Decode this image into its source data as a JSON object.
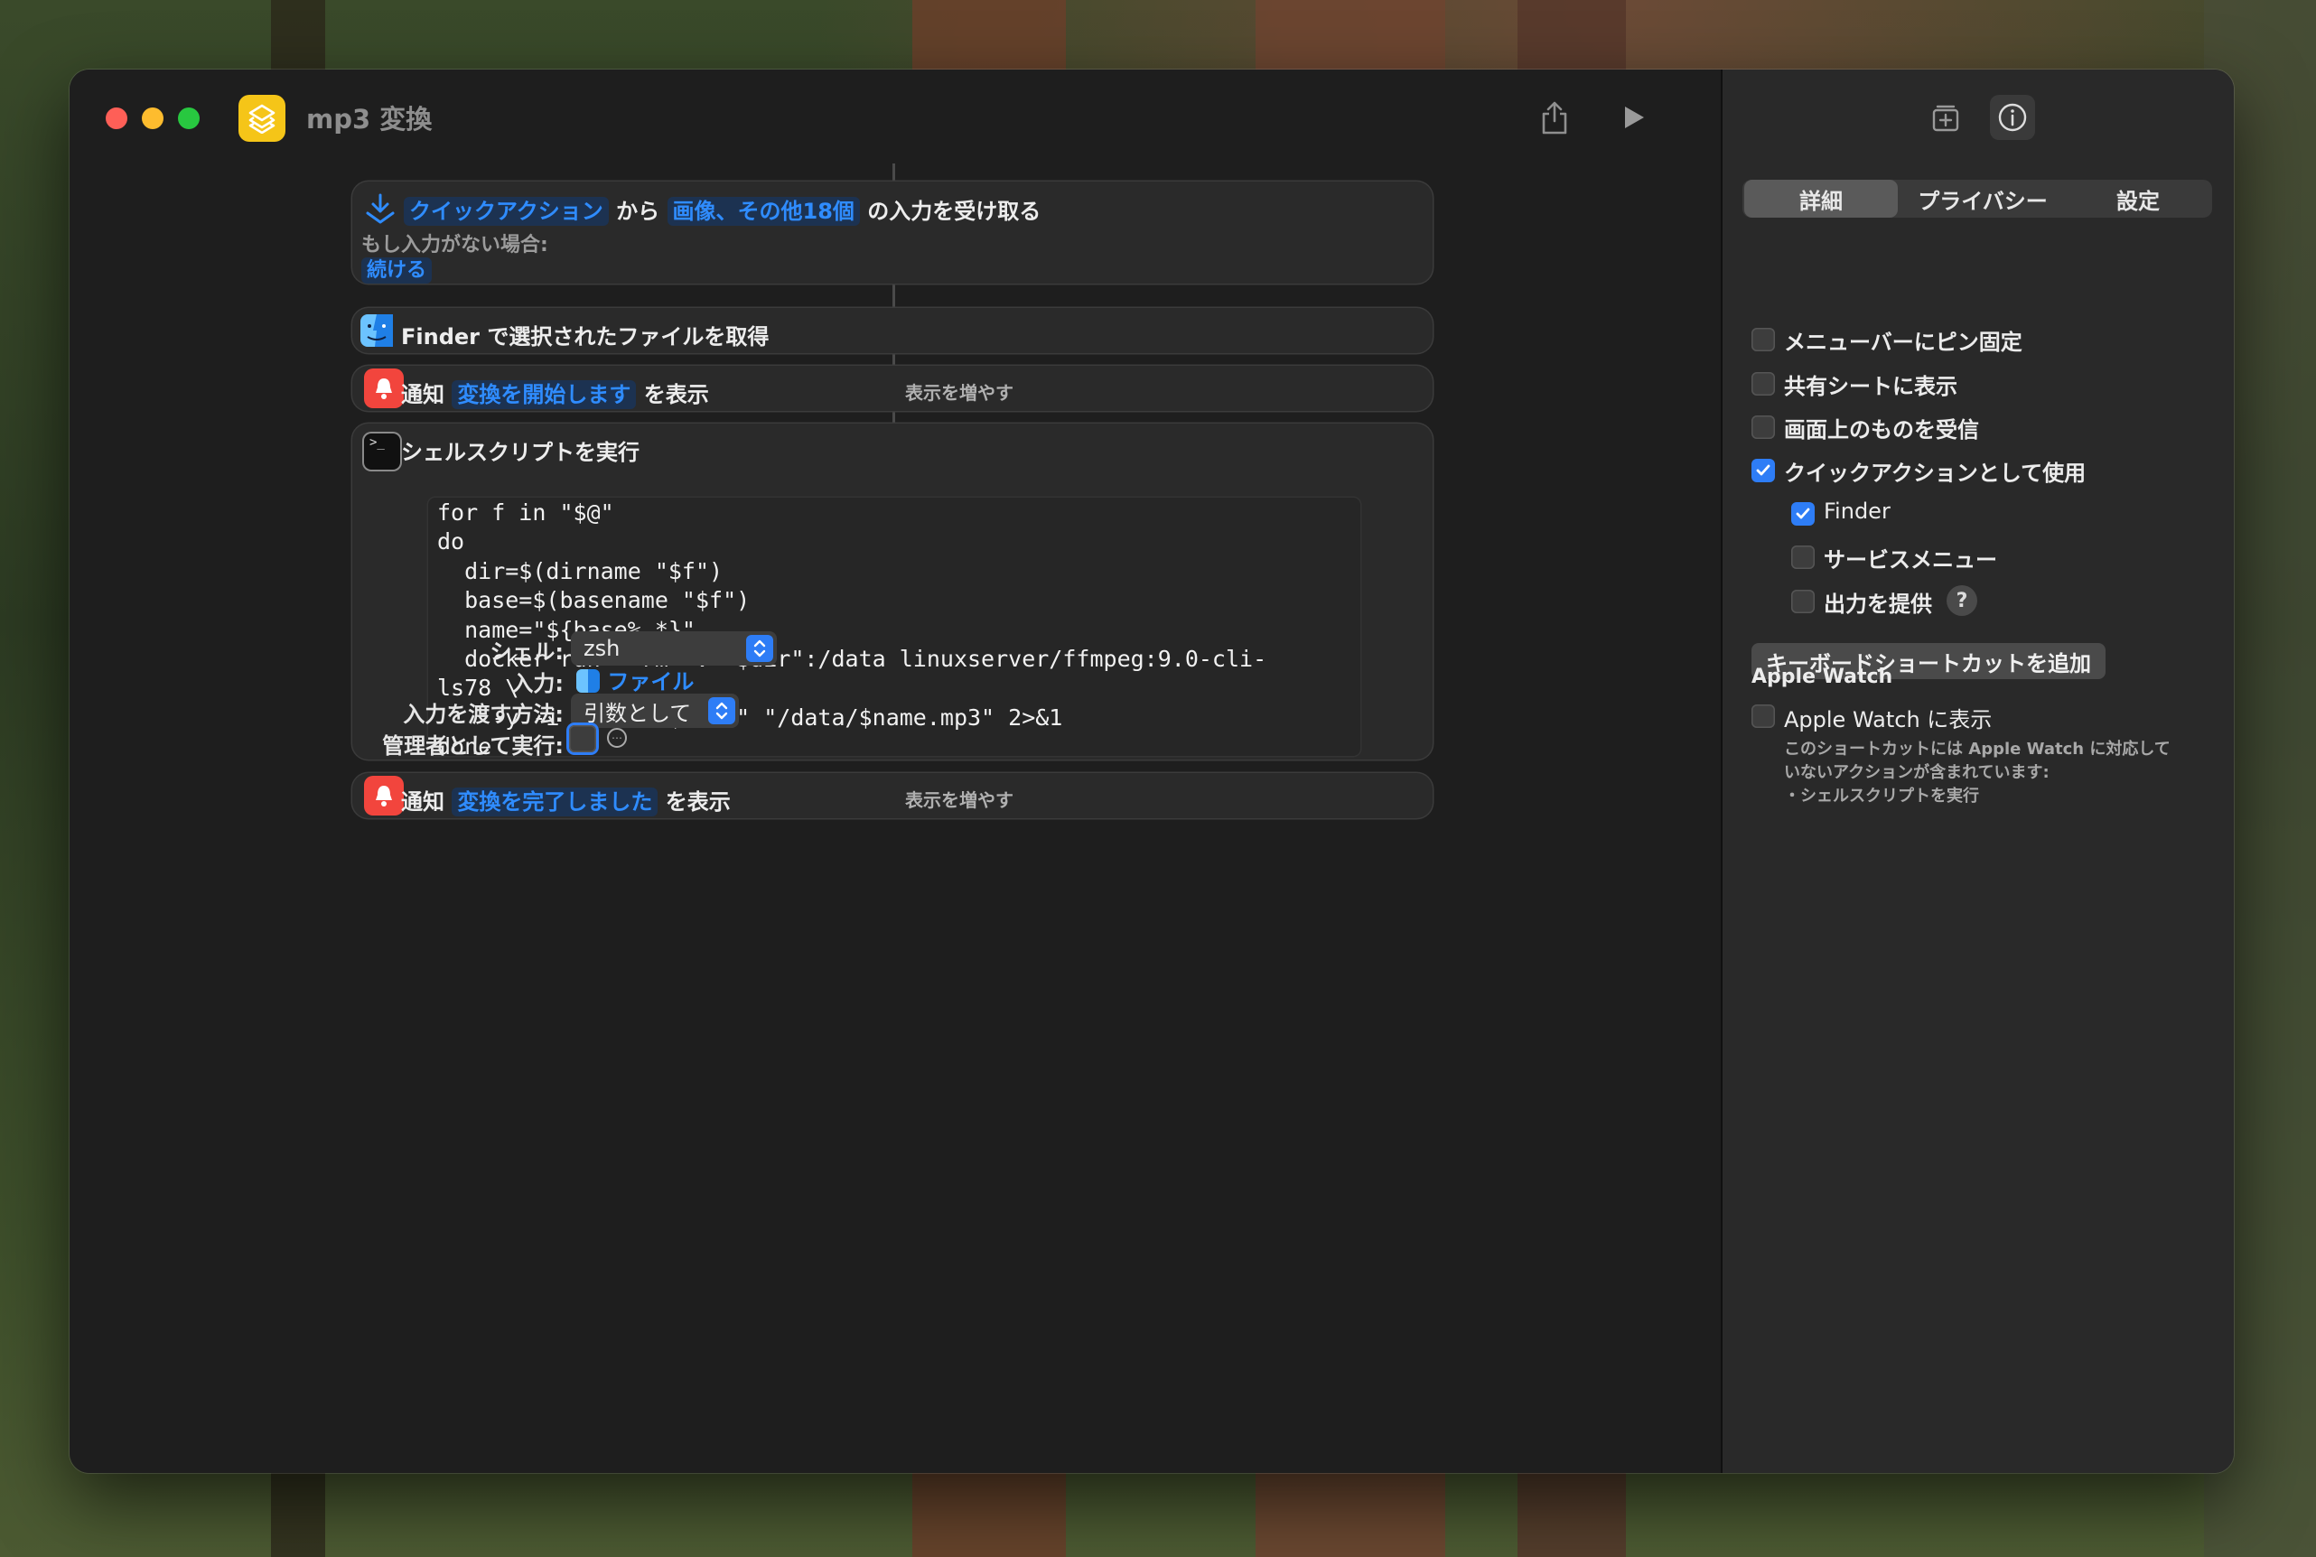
{
  "window": {
    "title": "mp3 変換"
  },
  "workflow": {
    "receive": {
      "source": "クイックアクション",
      "from": "から",
      "types": "画像、その他18個",
      "suffix": "の入力を受け取る",
      "no_input_label": "もし入力がない場合:",
      "no_input_action": "続ける"
    },
    "finder": {
      "label": "Finder で選択されたファイルを取得"
    },
    "notify1": {
      "prefix": "通知",
      "message": "変換を開始します",
      "suffix": "を表示",
      "more": "表示を増やす"
    },
    "shell": {
      "title": "シェルスクリプトを実行",
      "code": [
        "for f in \"$@\"",
        "do",
        "  dir=$(dirname \"$f\")",
        "  base=$(basename \"$f\")",
        "  name=\"${base%.*}\"",
        "  docker run --rm -v \"$dir\":/data linuxserver/ffmpeg:9.0-cli-",
        "ls78 \\",
        "    -y -i \"/data/$base\" \"/data/$name.mp3\" 2>&1",
        "done"
      ],
      "shell_label": "シェル:",
      "shell_value": "zsh",
      "input_label": "入力:",
      "input_value": "ファイル",
      "pass_label": "入力を渡す方法:",
      "pass_value": "引数として",
      "admin_label": "管理者として実行:"
    },
    "notify2": {
      "prefix": "通知",
      "message": "変換を完了しました",
      "suffix": "を表示",
      "more": "表示を増やす"
    }
  },
  "inspector": {
    "tabs": [
      "詳細",
      "プライバシー",
      "設定"
    ],
    "active_tab": "詳細",
    "options": [
      {
        "label": "メニューバーにピン固定",
        "checked": false
      },
      {
        "label": "共有シートに表示",
        "checked": false
      },
      {
        "label": "画面上のものを受信",
        "checked": false
      },
      {
        "label": "クイックアクションとして使用",
        "checked": true
      },
      {
        "label": "Finder",
        "checked": true
      },
      {
        "label": "サービスメニュー",
        "checked": false
      },
      {
        "label": "出力を提供",
        "checked": false
      }
    ],
    "help": "?",
    "shortcut_button": "キーボードショートカットを追加",
    "watch_heading": "Apple Watch",
    "watch_option": "Apple Watch に表示",
    "watch_note": "このショートカットには Apple Watch に対応して\nいないアクションが含まれています:\n・シェルスクリプトを実行"
  },
  "colors": {
    "accent": "#2e7df6",
    "token": "#2f8cff",
    "notify": "#f2453d",
    "app_icon": "#f5c518"
  },
  "icons": [
    "share-icon",
    "play-icon",
    "add-to-library-icon",
    "info-icon",
    "quick-action-icon",
    "finder-icon",
    "bell-icon",
    "terminal-icon",
    "more-icon"
  ]
}
